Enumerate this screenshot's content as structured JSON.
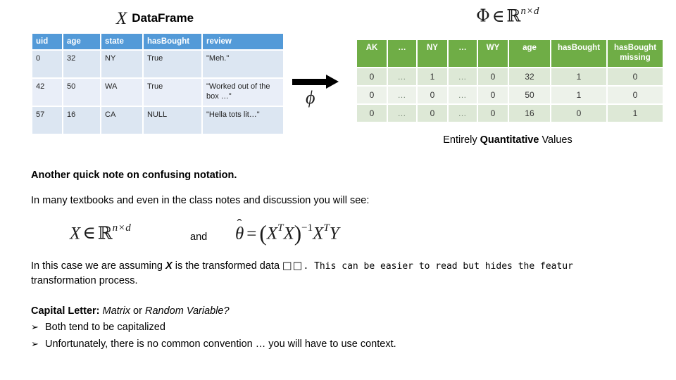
{
  "left_panel": {
    "symbol": "X",
    "title": "DataFrame",
    "columns": [
      "uid",
      "age",
      "state",
      "hasBought",
      "review"
    ],
    "rows": [
      [
        "0",
        "32",
        "NY",
        "True",
        "\"Meh.\""
      ],
      [
        "42",
        "50",
        "WA",
        "True",
        "\"Worked out of the box …\""
      ],
      [
        "57",
        "16",
        "CA",
        "NULL",
        "\"Hella tots lit…\""
      ]
    ],
    "header_color": "#539ad8",
    "row_color_odd": "#dce6f2",
    "row_color_even": "#e9eef8"
  },
  "transform": {
    "arrow_name": "right-arrow",
    "phi_symbol": "ϕ"
  },
  "right_panel": {
    "formula": {
      "phi": "Φ",
      "element_of": "∈",
      "reals": "ℝ",
      "superscript": "n×d"
    },
    "columns": [
      "AK",
      "…",
      "NY",
      "…",
      "WY",
      "age",
      "hasBought",
      "hasBought missing"
    ],
    "rows": [
      [
        "0",
        "…",
        "1",
        "…",
        "0",
        "32",
        "1",
        "0"
      ],
      [
        "0",
        "…",
        "0",
        "…",
        "0",
        "50",
        "1",
        "0"
      ],
      [
        "0",
        "…",
        "0",
        "…",
        "0",
        "16",
        "0",
        "1"
      ]
    ],
    "caption": {
      "pre": "Entirely ",
      "emphasis": "Quantitative",
      "post": " Values"
    },
    "header_color": "#6fad46",
    "row_color_odd": "#dde8d6",
    "row_color_even": "#edf2ea"
  },
  "notes": {
    "heading": "Another quick note on confusing notation.",
    "intro": "In many textbooks and even in the class notes and discussion you will see:",
    "formula_x": {
      "var": "X",
      "element_of": "∈",
      "reals": "ℝ",
      "superscript": "n×d"
    },
    "conjunction": "and",
    "formula_theta": {
      "theta": "θ",
      "equals": "=",
      "open_paren": "(",
      "xt": "X",
      "t1": "T",
      "x2": "X",
      "close_paren": ")",
      "inverse": "−1",
      "x3": "X",
      "t2": "T",
      "y": "Y"
    },
    "assumption": {
      "pre": "In this case we are assuming ",
      "var": "X",
      "mid": " is the transformed data ",
      "tofu": "□□",
      "mono_tail": ". This can be easier to read but hides the featur",
      "line2": "transformation process."
    },
    "capital": {
      "lead": "Capital Letter:",
      "option_a": "Matrix",
      "conjunction": "or",
      "option_b": "Random Variable?",
      "bullet_glyph": "➢",
      "bullets": [
        "Both tend to be capitalized",
        "Unfortunately, there is no common convention … you will have to use context."
      ]
    }
  }
}
